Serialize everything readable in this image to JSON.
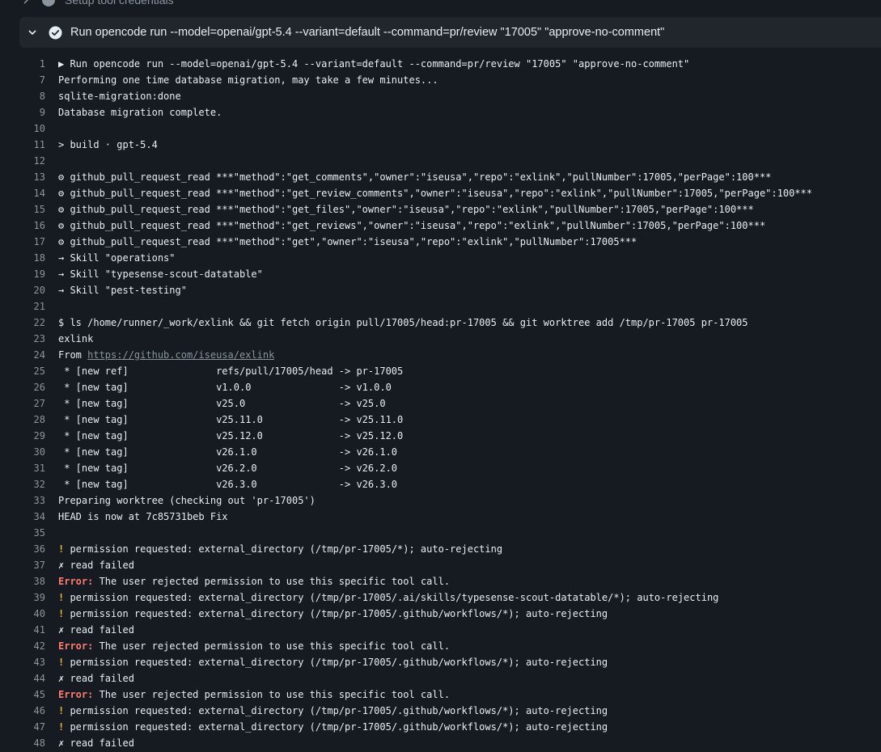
{
  "previous_step": {
    "title": "Setup tool credentials"
  },
  "step": {
    "title": "Run opencode run --model=openai/gpt-5.4 --variant=default --command=pr/review \"17005\" \"approve-no-comment\"",
    "status_color": "#e6edf3"
  },
  "log": {
    "lines": [
      {
        "n": "1",
        "text": "▶ Run opencode run --model=openai/gpt-5.4 --variant=default --command=pr/review \"17005\" \"approve-no-comment\""
      },
      {
        "n": "7",
        "text": "Performing one time database migration, may take a few minutes..."
      },
      {
        "n": "8",
        "text": "sqlite-migration:done"
      },
      {
        "n": "9",
        "text": "Database migration complete."
      },
      {
        "n": "10",
        "text": ""
      },
      {
        "n": "11",
        "text": "> build · gpt-5.4"
      },
      {
        "n": "12",
        "text": ""
      },
      {
        "n": "13",
        "text": "⚙ github_pull_request_read ***\"method\":\"get_comments\",\"owner\":\"iseusa\",\"repo\":\"exlink\",\"pullNumber\":17005,\"perPage\":100***"
      },
      {
        "n": "14",
        "text": "⚙ github_pull_request_read ***\"method\":\"get_review_comments\",\"owner\":\"iseusa\",\"repo\":\"exlink\",\"pullNumber\":17005,\"perPage\":100***"
      },
      {
        "n": "15",
        "text": "⚙ github_pull_request_read ***\"method\":\"get_files\",\"owner\":\"iseusa\",\"repo\":\"exlink\",\"pullNumber\":17005,\"perPage\":100***"
      },
      {
        "n": "16",
        "text": "⚙ github_pull_request_read ***\"method\":\"get_reviews\",\"owner\":\"iseusa\",\"repo\":\"exlink\",\"pullNumber\":17005,\"perPage\":100***"
      },
      {
        "n": "17",
        "text": "⚙ github_pull_request_read ***\"method\":\"get\",\"owner\":\"iseusa\",\"repo\":\"exlink\",\"pullNumber\":17005***"
      },
      {
        "n": "18",
        "text": "→ Skill \"operations\""
      },
      {
        "n": "19",
        "text": "→ Skill \"typesense-scout-datatable\""
      },
      {
        "n": "20",
        "text": "→ Skill \"pest-testing\""
      },
      {
        "n": "21",
        "text": ""
      },
      {
        "n": "22",
        "text": "$ ls /home/runner/_work/exlink && git fetch origin pull/17005/head:pr-17005 && git worktree add /tmp/pr-17005 pr-17005"
      },
      {
        "n": "23",
        "text": "exlink"
      },
      {
        "n": "24",
        "prefix": "From ",
        "link": "https://github.com/iseusa/exlink"
      },
      {
        "n": "25",
        "text": " * [new ref]               refs/pull/17005/head -> pr-17005"
      },
      {
        "n": "26",
        "text": " * [new tag]               v1.0.0               -> v1.0.0"
      },
      {
        "n": "27",
        "text": " * [new tag]               v25.0                -> v25.0"
      },
      {
        "n": "28",
        "text": " * [new tag]               v25.11.0             -> v25.11.0"
      },
      {
        "n": "29",
        "text": " * [new tag]               v25.12.0             -> v25.12.0"
      },
      {
        "n": "30",
        "text": " * [new tag]               v26.1.0              -> v26.1.0"
      },
      {
        "n": "31",
        "text": " * [new tag]               v26.2.0              -> v26.2.0"
      },
      {
        "n": "32",
        "text": " * [new tag]               v26.3.0              -> v26.3.0"
      },
      {
        "n": "33",
        "text": "Preparing worktree (checking out 'pr-17005')"
      },
      {
        "n": "34",
        "text": "HEAD is now at 7c85731beb Fix"
      },
      {
        "n": "35",
        "text": ""
      },
      {
        "n": "36",
        "kind": "warn",
        "marker": "!",
        "text": " permission requested: external_directory (/tmp/pr-17005/*); auto-rejecting"
      },
      {
        "n": "37",
        "text": "✗ read failed"
      },
      {
        "n": "38",
        "kind": "err",
        "marker": "Error:",
        "text": " The user rejected permission to use this specific tool call."
      },
      {
        "n": "39",
        "kind": "warn",
        "marker": "!",
        "text": " permission requested: external_directory (/tmp/pr-17005/.ai/skills/typesense-scout-datatable/*); auto-rejecting"
      },
      {
        "n": "40",
        "kind": "warn",
        "marker": "!",
        "text": " permission requested: external_directory (/tmp/pr-17005/.github/workflows/*); auto-rejecting"
      },
      {
        "n": "41",
        "text": "✗ read failed"
      },
      {
        "n": "42",
        "kind": "err",
        "marker": "Error:",
        "text": " The user rejected permission to use this specific tool call."
      },
      {
        "n": "43",
        "kind": "warn",
        "marker": "!",
        "text": " permission requested: external_directory (/tmp/pr-17005/.github/workflows/*); auto-rejecting"
      },
      {
        "n": "44",
        "text": "✗ read failed"
      },
      {
        "n": "45",
        "kind": "err",
        "marker": "Error:",
        "text": " The user rejected permission to use this specific tool call."
      },
      {
        "n": "46",
        "kind": "warn",
        "marker": "!",
        "text": " permission requested: external_directory (/tmp/pr-17005/.github/workflows/*); auto-rejecting"
      },
      {
        "n": "47",
        "kind": "warn",
        "marker": "!",
        "text": " permission requested: external_directory (/tmp/pr-17005/.github/workflows/*); auto-rejecting"
      },
      {
        "n": "48",
        "text": "✗ read failed"
      }
    ]
  }
}
